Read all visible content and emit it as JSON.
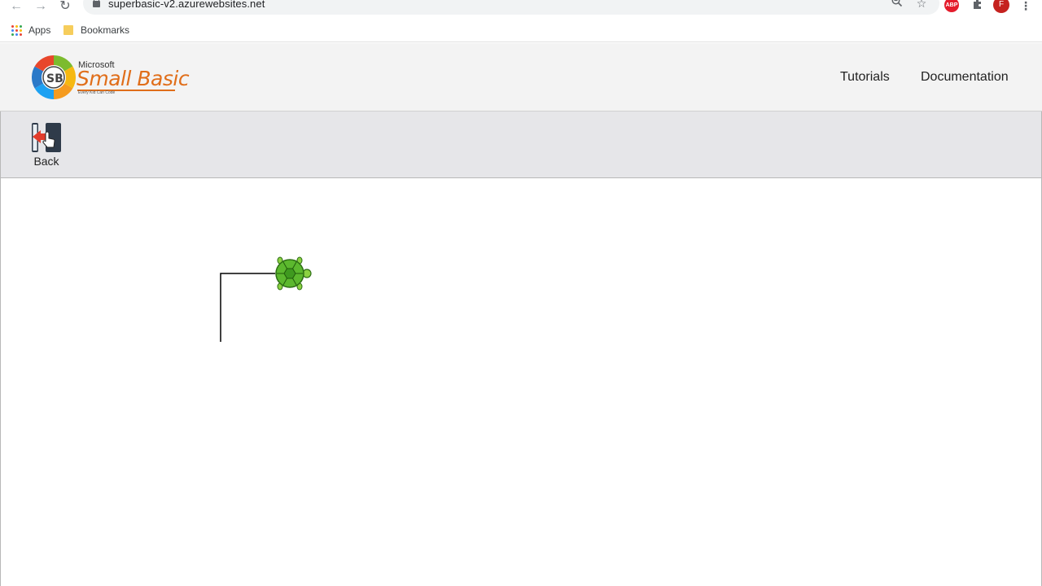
{
  "browser": {
    "url": "superbasic-v2.azurewebsites.net",
    "profile_initial": "F",
    "extension_abp": "ABP",
    "bookmarks": [
      {
        "label": "Apps",
        "icon": "apps-grid-icon"
      },
      {
        "label": "Bookmarks",
        "icon": "folder-icon"
      }
    ]
  },
  "site": {
    "brand_small": "Microsoft",
    "brand_big": "Small Basic",
    "brand_tagline": "Every Kid Can Code",
    "nav": [
      {
        "label": "Tutorials"
      },
      {
        "label": "Documentation"
      }
    ]
  },
  "actions": {
    "back_label": "Back"
  },
  "colors": {
    "brand_orange": "#e06e1a",
    "turtle_green": "#5cb82e"
  }
}
